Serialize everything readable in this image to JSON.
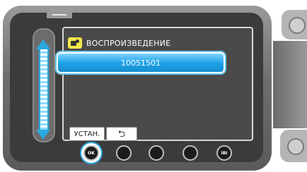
{
  "screen": {
    "mode_icon": "playback-video-icon",
    "title": "ВОСПРОИЗВЕДЕНИЕ",
    "selected_item": "10051501",
    "set_button_label": "УСТАН.",
    "back_button_icon": "return-arrow-icon",
    "back_glyph": "⮌"
  },
  "hardware_buttons": [
    {
      "name": "ok-button",
      "label": "OK"
    },
    {
      "name": "hw-button-2",
      "label": ""
    },
    {
      "name": "hw-button-3",
      "label": ""
    },
    {
      "name": "hw-button-4",
      "label": ""
    },
    {
      "name": "hw-button-5",
      "label": "IBI"
    }
  ],
  "colors": {
    "accent": "#2aa8e0",
    "selection": "#1fa3e8",
    "screen_bg": "#4a4a4a",
    "body": "#6e6e6e"
  }
}
